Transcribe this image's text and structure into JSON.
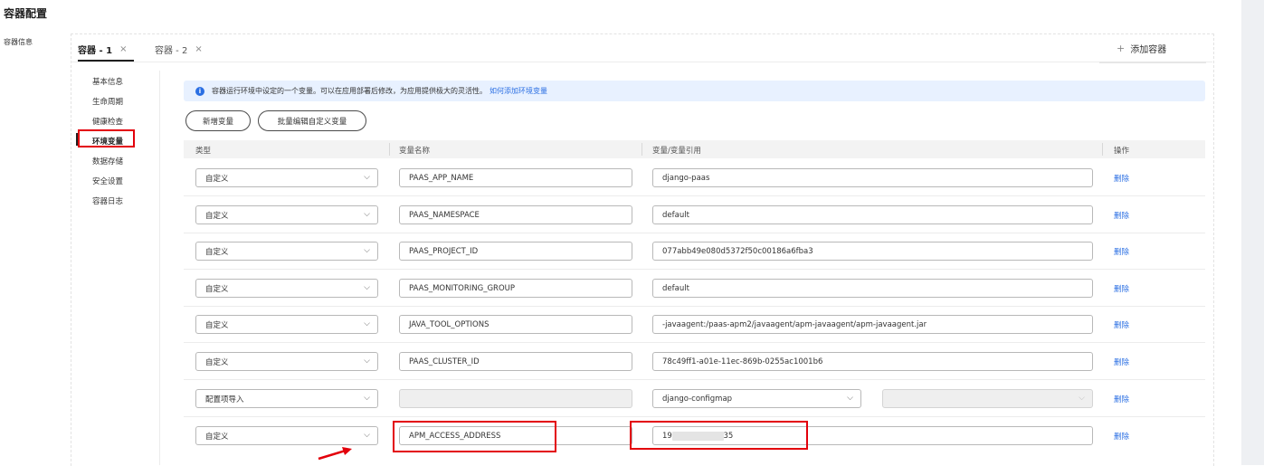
{
  "page_title": "容器配置",
  "side_label": "容器信息",
  "tabs": [
    {
      "label": "容器 - 1",
      "close": "×"
    },
    {
      "label": "容器 - 2",
      "close": "×"
    }
  ],
  "add_container": {
    "icon": "+",
    "label": "添加容器"
  },
  "submenu": [
    "基本信息",
    "生命周期",
    "健康检查",
    "环境变量",
    "数据存储",
    "安全设置",
    "容器日志"
  ],
  "notice": {
    "text": "容器运行环境中设定的一个变量。可以在应用部署后修改，为应用提供极大的灵活性。",
    "link": "如何添加环境变量"
  },
  "buttons": {
    "add_var": "新增变量",
    "batch_edit": "批量编辑自定义变量"
  },
  "columns": [
    "类型",
    "变量名称",
    "变量/变量引用",
    "操作"
  ],
  "rows": [
    {
      "type": "自定义",
      "name": "PAAS_APP_NAME",
      "value": "django-paas",
      "action": "删除"
    },
    {
      "type": "自定义",
      "name": "PAAS_NAMESPACE",
      "value": "default",
      "action": "删除"
    },
    {
      "type": "自定义",
      "name": "PAAS_PROJECT_ID",
      "value": "077abb49e080d5372f50c00186a6fba3",
      "action": "删除"
    },
    {
      "type": "自定义",
      "name": "PAAS_MONITORING_GROUP",
      "value": "default",
      "action": "删除"
    },
    {
      "type": "自定义",
      "name": "JAVA_TOOL_OPTIONS",
      "value": "-javaagent:/paas-apm2/javaagent/apm-javaagent/apm-javaagent.jar",
      "action": "删除"
    },
    {
      "type": "自定义",
      "name": "PAAS_CLUSTER_ID",
      "value": "78c49ff1-a01e-11ec-869b-0255ac1001b6",
      "action": "删除"
    },
    {
      "type": "配置项导入",
      "name": "",
      "value": "django-configmap",
      "action": "删除"
    },
    {
      "type": "自定义",
      "name": "APM_ACCESS_ADDRESS",
      "value_prefix": "19",
      "value_suffix": "35",
      "action": "删除"
    }
  ],
  "colors": {
    "accent": "#2b6fe3",
    "highlight": "#e3000b",
    "notice_bg": "#e8f1ff"
  }
}
